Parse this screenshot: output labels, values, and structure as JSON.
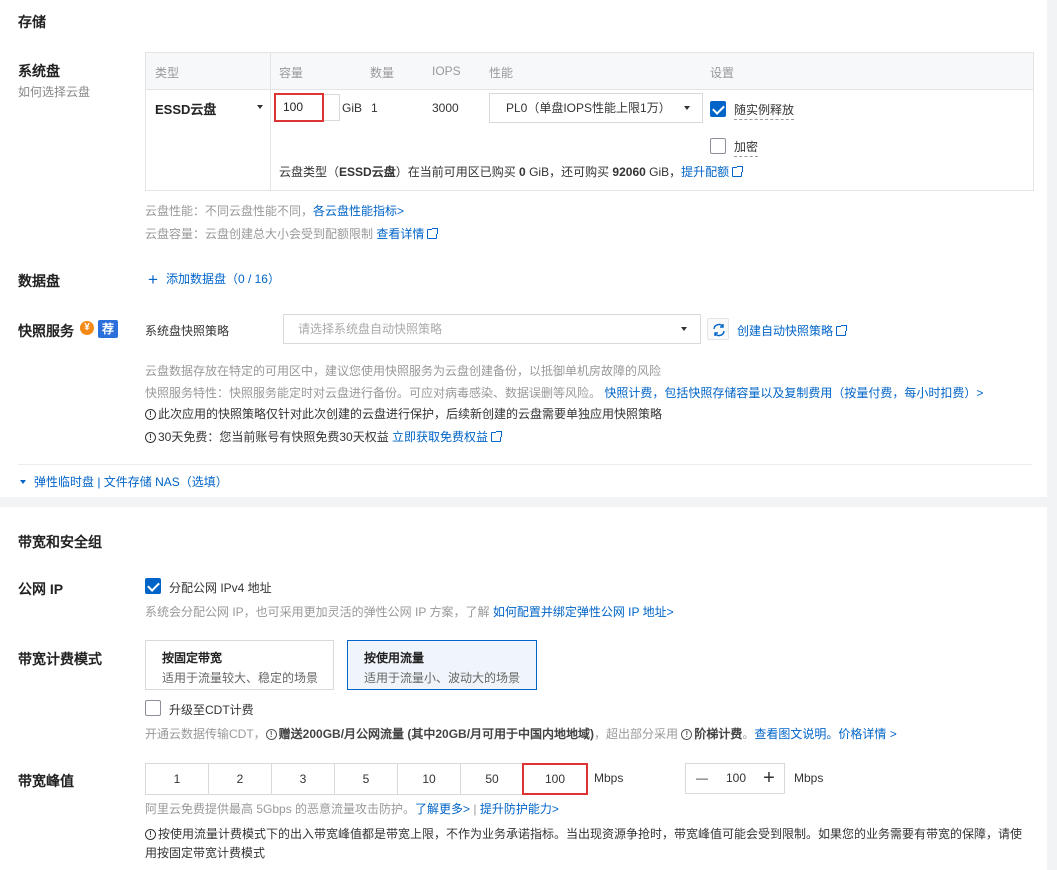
{
  "storage": {
    "title": "存储",
    "system_disk": {
      "label": "系统盘",
      "sub_link": "如何选择云盘",
      "headers": [
        "类型",
        "容量",
        "数量",
        "IOPS",
        "性能",
        "设置"
      ],
      "type_value": "ESSD云盘",
      "capacity_value": "100",
      "capacity_unit": "GiB",
      "count": "1",
      "iops": "3000",
      "perf_value": "PL0（单盘IOPS性能上限1万）",
      "release_label": "随实例释放",
      "release_checked": true,
      "encrypt_label": "加密",
      "encrypt_checked": false,
      "quota_pre": "云盘类型（",
      "quota_type": "ESSD云盘",
      "quota_mid1": "）在当前可用区已购买 ",
      "quota_bought": "0",
      "quota_mid2": " GiB，还可购买 ",
      "quota_left": "92060",
      "quota_mid3": " GiB，",
      "quota_link": "提升配额",
      "perf_note_pre": "云盘性能：不同云盘性能不同，",
      "perf_note_link": "各云盘性能指标>",
      "cap_note_pre": "云盘容量：云盘创建总大小会受到配额限制 ",
      "cap_note_link": "查看详情"
    },
    "data_disk": {
      "label": "数据盘",
      "add_label": "添加数据盘（0 / 16）"
    },
    "snapshot": {
      "label": "快照服务",
      "badge_fee": "¥",
      "badge_rec": "荐",
      "policy_label": "系统盘快照策略",
      "policy_placeholder": "请选择系统盘自动快照策略",
      "create_link": "创建自动快照策略",
      "note1": "云盘数据存放在特定的可用区中，建议您使用快照服务为云盘创建备份，以抵御单机房故障的风险",
      "note2_pre": "快照服务特性：快照服务能定时对云盘进行备份。可应对病毒感染、数据误删等风险。",
      "note2_link": "快照计费，包括快照存储容量以及复制费用（按量付费，每小时扣费）>",
      "note3": "此次应用的快照策略仅针对此次创建的云盘进行保护，后续新创建的云盘需要单独应用快照策略",
      "note4_pre": "30天免费：您当前账号有快照免费30天权益 ",
      "note4_link": "立即获取免费权益"
    },
    "expand_label": "弹性临时盘 | 文件存储 NAS（选填）"
  },
  "network": {
    "title": "带宽和安全组",
    "public_ip": {
      "label": "公网 IP",
      "checkbox_label": "分配公网 IPv4 地址",
      "checked": true,
      "note_pre": "系统会分配公网 IP，也可采用更加灵活的弹性公网 IP 方案，了解 ",
      "note_link": "如何配置并绑定弹性公网 IP 地址>"
    },
    "billing": {
      "label": "带宽计费模式",
      "options": [
        {
          "title": "按固定带宽",
          "desc": "适用于流量较大、稳定的场景"
        },
        {
          "title": "按使用流量",
          "desc": "适用于流量小、波动大的场景"
        }
      ],
      "selected_index": 1,
      "cdt_label": "升级至CDT计费",
      "cdt_checked": false,
      "cdt_note_pre": "开通云数据传输CDT，",
      "cdt_note_bold": "赠送200GB/月公网流量 (其中20GB/月可用于中国内地地域)",
      "cdt_note_mid": "，超出部分采用 ",
      "cdt_note_bold2": "阶梯计费",
      "cdt_note_after": "。",
      "cdt_note_link": "查看图文说明。价格详情 >"
    },
    "peak": {
      "label": "带宽峰值",
      "options": [
        "1",
        "2",
        "3",
        "5",
        "10",
        "50",
        "100"
      ],
      "selected": "100",
      "unit": "Mbps",
      "stepper_minus": "—",
      "stepper_value": "100",
      "stepper_plus": "+",
      "stepper_unit": "Mbps",
      "ddos_note_pre": "阿里云免费提供最高 5Gbps 的恶意流量攻击防护。",
      "ddos_link1": "了解更多>",
      "ddos_sep": " | ",
      "ddos_link2": "提升防护能力>",
      "warn_line1": "按使用流量计费模式下的出入带宽峰值都是带宽上限，不作为业务承诺指标。当出现资源争抢时，带宽峰值可能会受到限制。如果您的业务需要有带宽的保障，请使",
      "warn_line2": "用按固定带宽计费模式"
    }
  },
  "colors": {
    "link": "#0064c8",
    "highlight": "#d33333",
    "checkbox": "#0064c8"
  }
}
